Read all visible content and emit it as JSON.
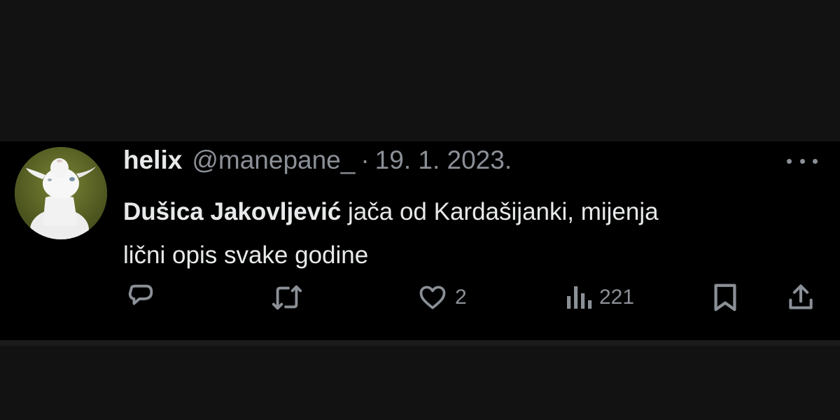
{
  "colors": {
    "background": "#121212",
    "tweet_background": "#000000",
    "primary_text": "#e7e9ea",
    "secondary_text": "#8b9097"
  },
  "tweet": {
    "author": {
      "display_name": "helix",
      "handle": "@manepane_",
      "avatar_icon": "white-goat-avatar"
    },
    "separator": "·",
    "date": "19. 1. 2023.",
    "text": {
      "mention": "Dušica Jakovljević",
      "line1_rest": " jača od Kardašijanki, mijenja",
      "line2": "lični opis svake godine"
    },
    "actions": {
      "reply": {
        "icon": "reply-icon"
      },
      "retweet": {
        "icon": "retweet-icon"
      },
      "like": {
        "icon": "heart-icon",
        "count": "2"
      },
      "views": {
        "icon": "views-icon",
        "count": "221"
      },
      "bookmark": {
        "icon": "bookmark-icon"
      },
      "share": {
        "icon": "share-icon"
      }
    },
    "more_icon": "more-options-icon"
  }
}
